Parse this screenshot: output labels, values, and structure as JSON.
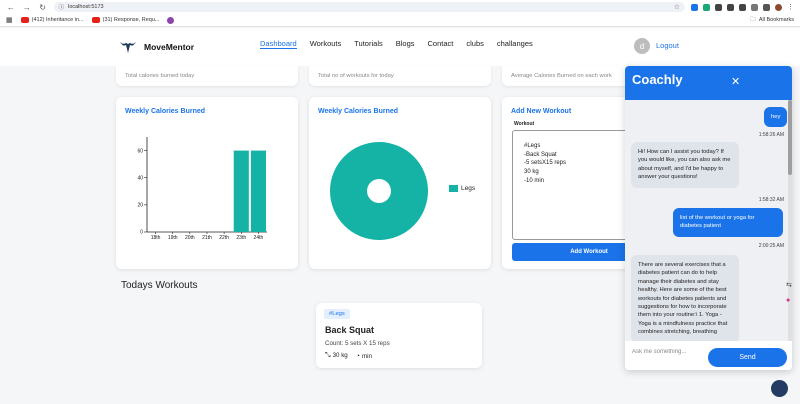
{
  "browser": {
    "url": "localhost:5173",
    "bookmarks": [
      {
        "label": "(412) Inheritance in..."
      },
      {
        "label": "(31) Response, Requ..."
      }
    ],
    "all_bookmarks": "All Bookmarks"
  },
  "header": {
    "brand": "MoveMentor",
    "nav": [
      "Dashboard",
      "Workouts",
      "Tutorials",
      "Blogs",
      "Contact",
      "clubs",
      "challanges"
    ],
    "avatar_letter": "d",
    "logout": "Logout"
  },
  "stats": [
    "Total calories burned today",
    "Total no of workouts for today",
    "Average Calories Burned on each work"
  ],
  "bar_card": {
    "title": "Weekly Calories Burned"
  },
  "donut_card": {
    "title": "Weekly Calories Burned"
  },
  "chart_data": [
    {
      "type": "bar",
      "title": "Weekly Calories Burned",
      "categories": [
        "18th",
        "19th",
        "20th",
        "21th",
        "22th",
        "23th",
        "24th"
      ],
      "values": [
        0,
        0,
        0,
        0,
        0,
        60,
        60
      ],
      "ylim": [
        0,
        70
      ],
      "yticks": [
        0,
        20,
        40,
        60
      ],
      "color": "#14b3a6"
    },
    {
      "type": "pie",
      "title": "Weekly Calories Burned",
      "labels": [
        "Legs"
      ],
      "values": [
        100
      ],
      "color": "#14b3a6"
    }
  ],
  "add_workout": {
    "title": "Add New Workout",
    "label": "Workout",
    "text": "#Legs\n-Back Squat\n-5 setsX15 reps\n30 kg\n-10 min",
    "button": "Add Workout"
  },
  "today": {
    "title": "Todays Workouts",
    "card": {
      "tag": "#Legs",
      "name": "Back Squat",
      "count": "Count: 5 sets X 15 reps",
      "weight": "30 kg",
      "duration": "min"
    }
  },
  "chat": {
    "title": "Coachly",
    "messages": [
      {
        "from": "user",
        "text": "hey"
      },
      {
        "time": "1:58:26 AM"
      },
      {
        "from": "bot",
        "text": "Hi! How can I assist you today? If you would like, you can also ask me about myself, and I'd be happy to answer your questions!"
      },
      {
        "time": "1:58:32 AM"
      },
      {
        "from": "user",
        "text": "list of the workout or yoga for diabetes patient"
      },
      {
        "time": "2:00:25 AM"
      },
      {
        "from": "bot",
        "text": "There are several exercises that a diabetes patient can do to help manage their diabetes and stay healthy. Here are some of the best workouts for diabetes patients and suggestions for how to incorporate them into your routine:\\ 1. Yoga - Yoga is a mindfulness practice that combines stretching, breathing"
      }
    ],
    "input_placeholder": "Ask me something...",
    "send": "Send"
  }
}
